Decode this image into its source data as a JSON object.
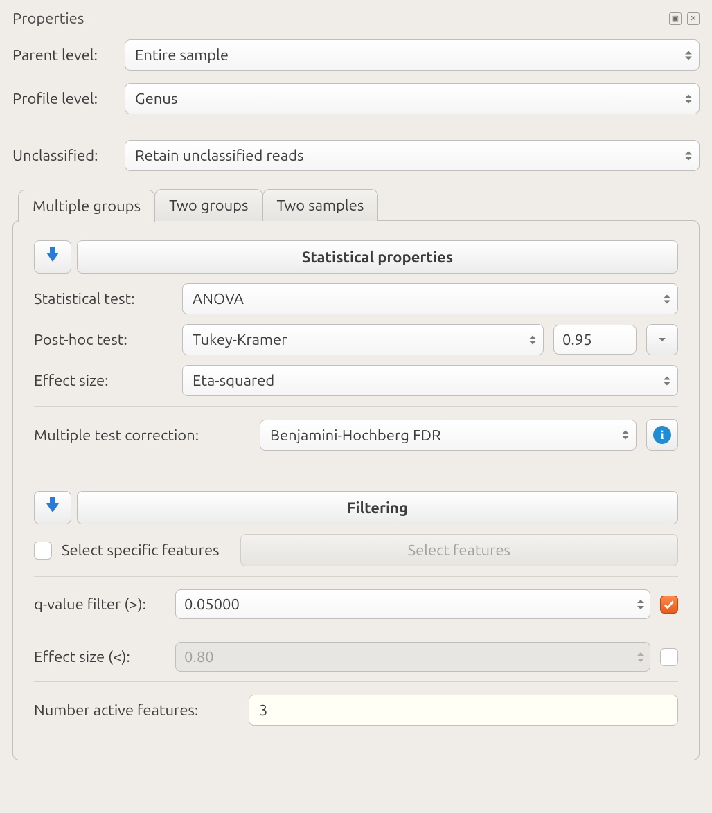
{
  "titlebar": {
    "title": "Properties"
  },
  "top": {
    "parent_level_label": "Parent level:",
    "parent_level_value": "Entire sample",
    "profile_level_label": "Profile level:",
    "profile_level_value": "Genus",
    "unclassified_label": "Unclassified:",
    "unclassified_value": "Retain unclassified reads"
  },
  "tabs": {
    "multiple_groups": "Multiple groups",
    "two_groups": "Two groups",
    "two_samples": "Two samples"
  },
  "stat": {
    "section_title": "Statistical properties",
    "statistical_test_label": "Statistical test:",
    "statistical_test_value": "ANOVA",
    "posthoc_label": "Post-hoc test:",
    "posthoc_value": "Tukey-Kramer",
    "posthoc_alpha": "0.95",
    "effect_size_label": "Effect size:",
    "effect_size_value": "Eta-squared",
    "mtc_label": "Multiple test correction:",
    "mtc_value": "Benjamini-Hochberg FDR"
  },
  "filter": {
    "section_title": "Filtering",
    "select_specific_label": "Select specific features",
    "select_features_btn": "Select features",
    "qvalue_label": "q-value filter (>):",
    "qvalue_value": "0.05000",
    "effect_size_label": "Effect size (<):",
    "effect_size_value": "0.80",
    "num_active_label": "Number active features:",
    "num_active_value": "3"
  }
}
